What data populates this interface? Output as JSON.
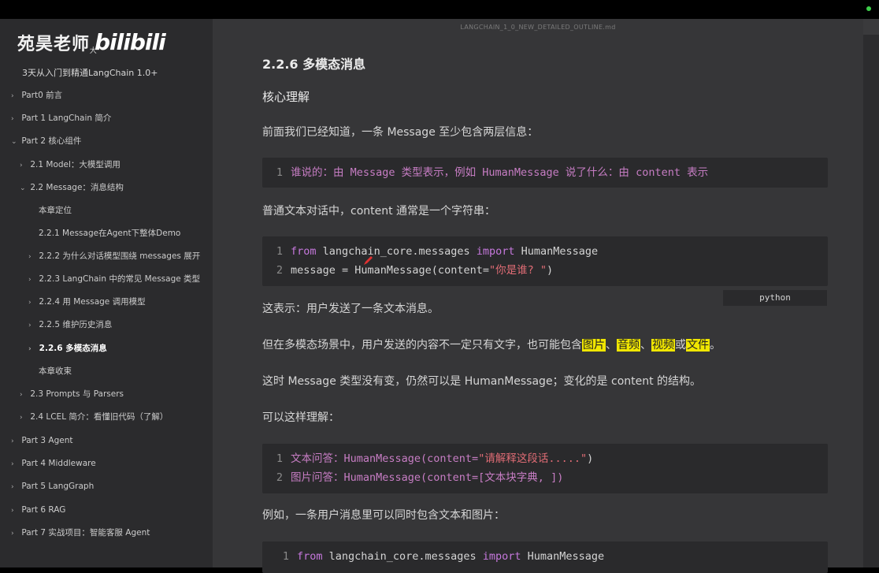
{
  "window": {
    "filename": "LANGCHAIN_1_0_NEW_DETAILED_OUTLINE.md"
  },
  "watermark": {
    "name": "苑昊老师",
    "logo": "bilibili",
    "sub": "大"
  },
  "sidebar": {
    "outline_title": "3天从入门到精通LangChain 1.0+",
    "items": [
      {
        "label": "Part0 前言",
        "chev": "›"
      },
      {
        "label": "Part 1 LangChain 简介",
        "chev": "›"
      },
      {
        "label": "Part 2 核心组件",
        "chev": "⌄"
      },
      {
        "label": "2.1 Model：大模型调用",
        "chev": "›"
      },
      {
        "label": "2.2 Message：消息结构",
        "chev": "⌄"
      },
      {
        "label": "本章定位",
        "chev": ""
      },
      {
        "label": "2.2.1 Message在Agent下整体Demo",
        "chev": ""
      },
      {
        "label": "2.2.2 为什么对话模型围绕 messages 展开",
        "chev": "›"
      },
      {
        "label": "2.2.3 LangChain 中的常见 Message 类型",
        "chev": "›"
      },
      {
        "label": "2.2.4 用 Message 调用模型",
        "chev": "›"
      },
      {
        "label": "2.2.5 维护历史消息",
        "chev": "›"
      },
      {
        "label": "2.2.6 多模态消息",
        "chev": "›"
      },
      {
        "label": "本章收束",
        "chev": ""
      },
      {
        "label": "2.3 Prompts 与 Parsers",
        "chev": "›"
      },
      {
        "label": "2.4 LCEL 简介：看懂旧代码（了解）",
        "chev": "›"
      },
      {
        "label": "Part 3 Agent",
        "chev": "›"
      },
      {
        "label": "Part 4 Middleware",
        "chev": "›"
      },
      {
        "label": "Part 5 LangGraph",
        "chev": "›"
      },
      {
        "label": "Part 6 RAG",
        "chev": "›"
      },
      {
        "label": "Part 7 实战项目：智能客服 Agent",
        "chev": "›"
      }
    ]
  },
  "content": {
    "heading": "2.2.6 多模态消息",
    "subheading": "核心理解",
    "p1": "前面我们已经知道，一条 Message 至少包含两层信息：",
    "code1": {
      "ln1": "1",
      "line1": "谁说的：由 Message 类型表示，例如 HumanMessage 说了什么：由 content 表示"
    },
    "p2": "普通文本对话中，content 通常是一个字符串：",
    "code2": {
      "ln1": "1",
      "l1_kw1": "from",
      "l1_mod": " langchain_core.messages ",
      "l1_kw2": "import",
      "l1_cls": " HumanMessage",
      "ln2": "2",
      "l2_a": "message = HumanMessage(content=",
      "l2_str": "\"你是谁? \"",
      "l2_b": ")",
      "lang": "python"
    },
    "p3": "这表示：用户发送了一条文本消息。",
    "p4": {
      "a": "但在多模态场景中，用户发送的内容不一定只有文字，也可能包含",
      "h1": "图片",
      "s1": "、",
      "h2": "音频",
      "s2": "、",
      "h3": "视频",
      "s3": "或",
      "h4": "文件",
      "end": "。"
    },
    "p5": "这时 Message 类型没有变，仍然可以是 HumanMessage；变化的是 content 的结构。",
    "p6": "可以这样理解：",
    "code3": {
      "ln1": "1",
      "l1_a": "文本问答：HumanMessage(content=",
      "l1_str": "\"请解释这段话.....\"",
      "l1_b": ")",
      "ln2": "2",
      "l2_a": "图片问答：HumanMessage(content=[文本块字典, ])"
    },
    "p7": "例如，一条用户消息里可以同时包含文本和图片：",
    "code4": {
      "ln1": "1",
      "l1_kw1": "from",
      "l1_mod": " langchain_core.messages ",
      "l1_kw2": "import",
      "l1_cls": " HumanMessage"
    }
  }
}
